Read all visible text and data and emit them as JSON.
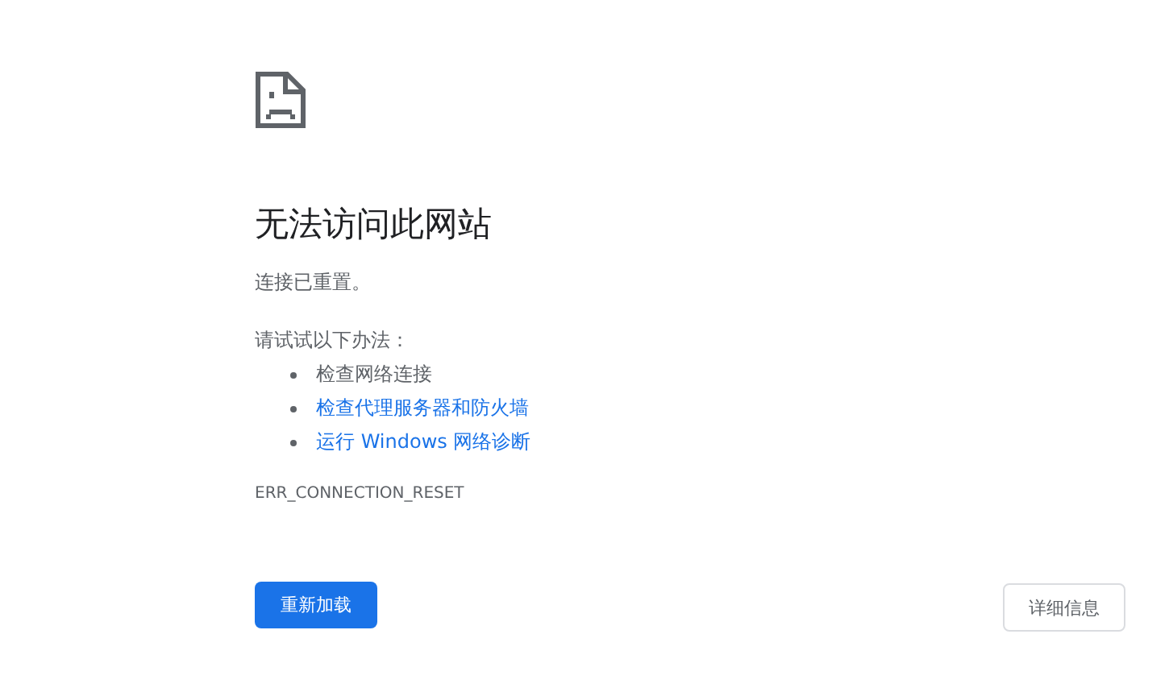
{
  "heading": "无法访问此网站",
  "summary": "连接已重置。",
  "suggestions_intro": "请试试以下办法：",
  "suggestions": [
    {
      "kind": "text",
      "text": "检查网络连接"
    },
    {
      "kind": "link",
      "text": "检查代理服务器和防火墙"
    },
    {
      "kind": "link",
      "text": "运行 Windows 网络诊断"
    }
  ],
  "error_code": "ERR_CONNECTION_RESET",
  "buttons": {
    "reload": "重新加载",
    "details": "详细信息"
  }
}
